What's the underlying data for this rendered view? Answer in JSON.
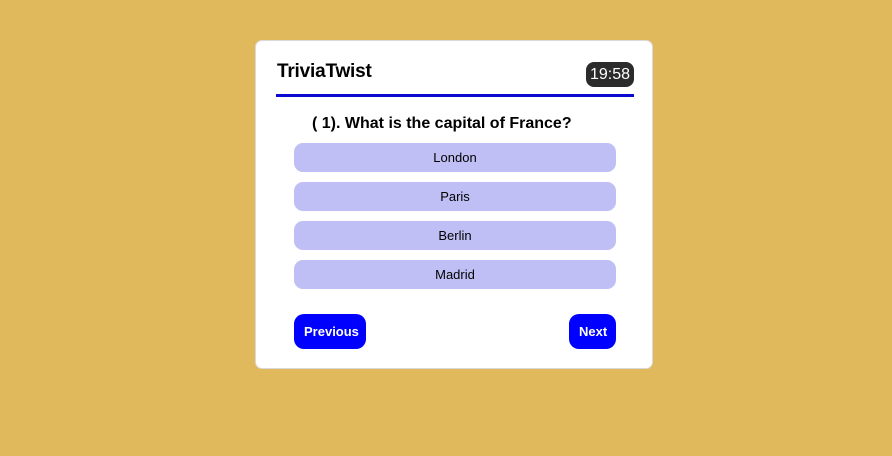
{
  "app": {
    "title": "TriviaTwist",
    "timer": "19:58"
  },
  "quiz": {
    "question": "( 1). What is the capital of France?",
    "options": [
      "London",
      "Paris",
      "Berlin",
      "Madrid"
    ]
  },
  "nav": {
    "previous_label": "Previous",
    "next_label": "Next"
  },
  "colors": {
    "background": "#e0b95c",
    "accent": "#0000ff",
    "option_bg": "#bfbff5",
    "timer_bg": "#2b2b2b"
  }
}
